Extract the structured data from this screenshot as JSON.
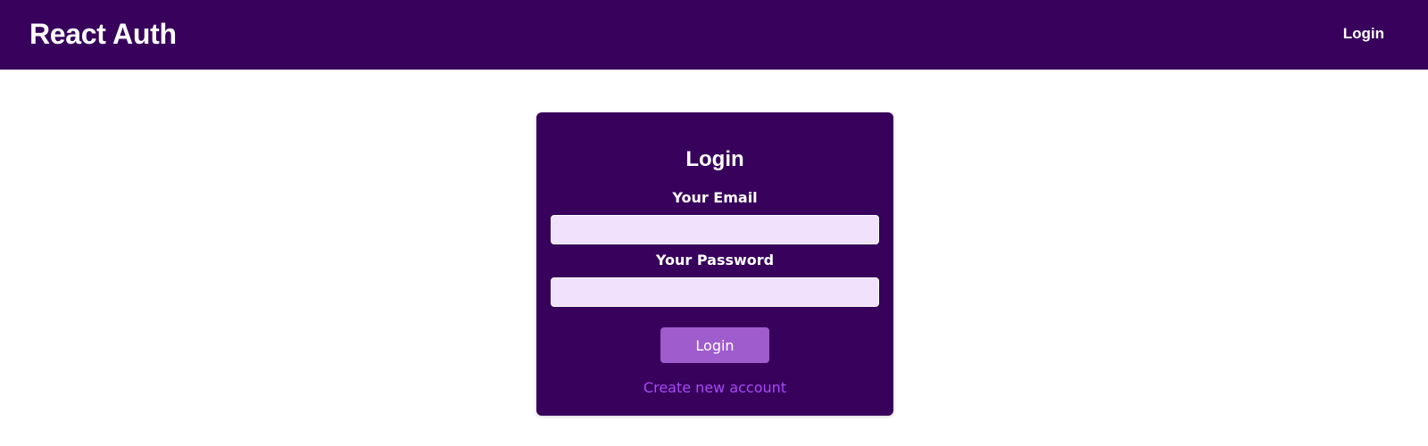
{
  "header": {
    "logo": "React Auth",
    "nav": {
      "login_label": "Login"
    }
  },
  "auth_form": {
    "title": "Login",
    "email": {
      "label": "Your Email",
      "value": "",
      "placeholder": ""
    },
    "password": {
      "label": "Your Password",
      "value": "",
      "placeholder": ""
    },
    "submit_label": "Login",
    "toggle_label": "Create new account"
  },
  "colors": {
    "brand": "#38015c",
    "input_background": "#f1e1fc",
    "button": "#9f5ccc",
    "link": "#a64bf4",
    "text_on_brand": "#ffffff"
  }
}
